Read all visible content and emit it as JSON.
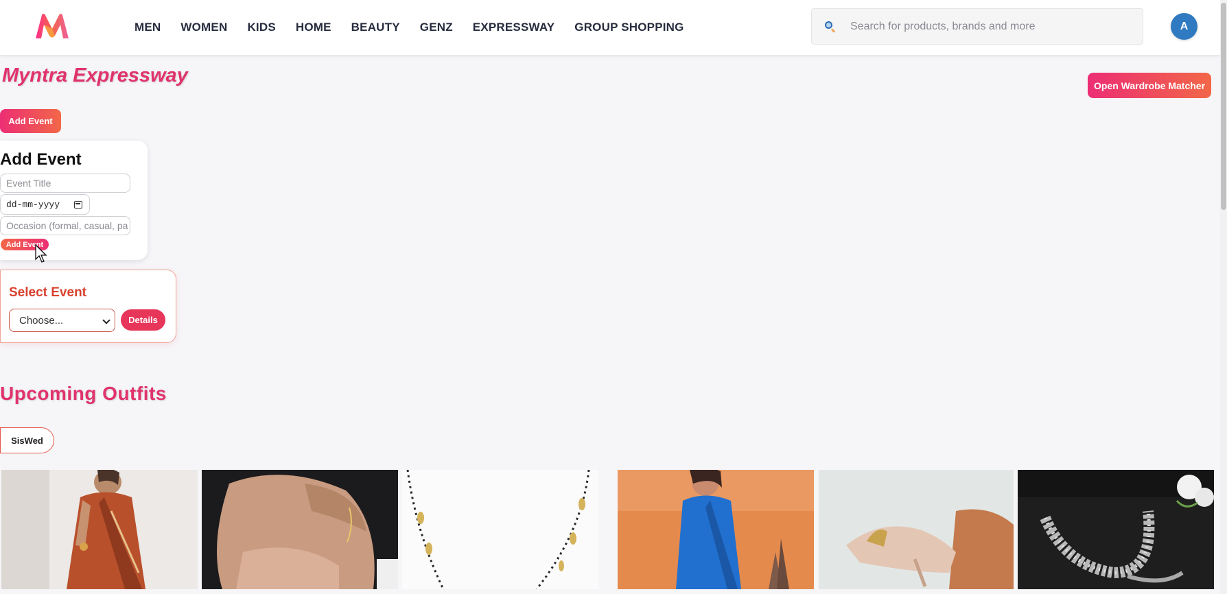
{
  "header": {
    "nav": [
      "MEN",
      "WOMEN",
      "KIDS",
      "HOME",
      "BEAUTY",
      "GENZ",
      "EXPRESSWAY",
      "GROUP SHOPPING"
    ],
    "search_placeholder": "Search for products, brands and more",
    "avatar_initial": "A"
  },
  "page": {
    "title": "Myntra Expressway",
    "wardrobe_button": "Open Wardrobe Matcher",
    "add_event_button": "Add Event"
  },
  "add_event_form": {
    "heading": "Add Event",
    "title_placeholder": "Event Title",
    "date_placeholder": "dd-mm-yyyy",
    "occasion_placeholder": "Occasion (formal, casual, pa",
    "submit_label": "Add Event"
  },
  "select_event": {
    "heading": "Select Event",
    "selected_option": "Choose...",
    "details_button": "Details"
  },
  "upcoming": {
    "heading": "Upcoming Outfits",
    "chips": [
      "SisWed"
    ],
    "products": [
      {
        "name": "rust-saree-image"
      },
      {
        "name": "bracelet-hand-image"
      },
      {
        "name": "mangalsutra-image"
      },
      {
        "name": "blue-saree-image"
      },
      {
        "name": "gold-heels-image"
      },
      {
        "name": "silver-anklet-image"
      }
    ]
  },
  "colors": {
    "brand_pink": "#e0336b",
    "gradient_start": "#ec2e74",
    "gradient_end": "#f26748",
    "avatar_blue": "#2f7ac0"
  }
}
